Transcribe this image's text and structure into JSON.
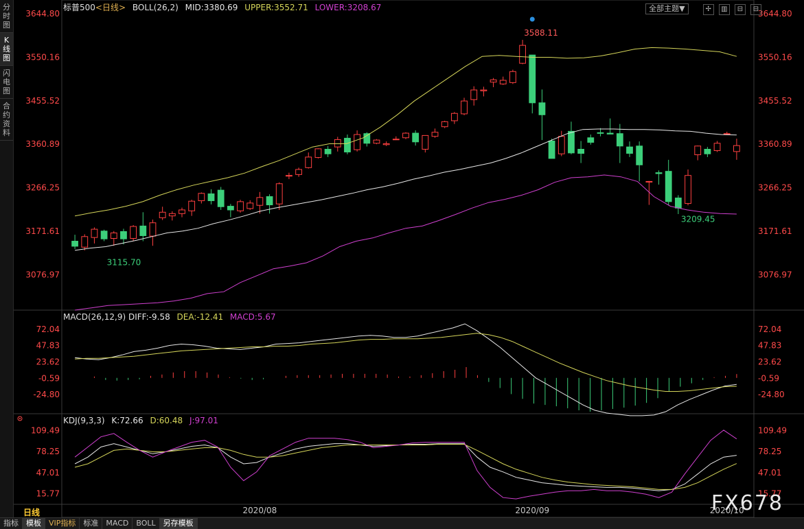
{
  "sidebar": {
    "tabs": [
      {
        "label": "分时图",
        "active": false
      },
      {
        "label": "K线图",
        "active": true
      },
      {
        "label": "闪电图",
        "active": false
      },
      {
        "label": "合约资料",
        "active": false
      }
    ]
  },
  "header": {
    "symbol": "标普500",
    "period": "<日线>",
    "boll": "BOLL(26,2)",
    "mid": "MID:3380.69",
    "upper": "UPPER:3552.71",
    "lower": "LOWER:3208.67"
  },
  "topbar": {
    "theme_select": "全部主题▼",
    "buttons": [
      "✢",
      "▥",
      "⊟",
      "⊟"
    ]
  },
  "macd_header": {
    "title": "MACD(26,12,9)",
    "diff": "DIFF:-9.58",
    "dea": "DEA:-12.41",
    "macd": "MACD:5.67"
  },
  "kdj_header": {
    "title": "KDJ(9,3,3)",
    "k": "K:72.66",
    "d": "D:60.48",
    "j": "J:97.01"
  },
  "period_label": "日线",
  "bottom_tabs": [
    {
      "label": "指标",
      "active": false,
      "vip": false
    },
    {
      "label": "模板",
      "active": true,
      "vip": false
    },
    {
      "label": "VIP指标",
      "active": false,
      "vip": true
    },
    {
      "label": "标准",
      "active": false,
      "vip": false
    },
    {
      "label": "MACD",
      "active": false,
      "vip": false
    },
    {
      "label": "BOLL",
      "active": false,
      "vip": false
    },
    {
      "label": "另存模板",
      "active": true,
      "vip": false
    }
  ],
  "watermark": "FX678",
  "colors": {
    "up": "#ff4040",
    "down": "#3ccf7a",
    "mid": "#e8e8e8",
    "upper": "#d6d65a",
    "lower": "#d040d0",
    "axis": "#ff4a4a",
    "dea": "#d6d65a",
    "j": "#d040d0"
  },
  "chart_data": {
    "type": "candlestick",
    "price_axis": {
      "ticks": [
        "3644.80",
        "3550.16",
        "3455.52",
        "3360.89",
        "3266.25",
        "3171.61",
        "3076.97"
      ],
      "range": [
        3000,
        3644.8
      ]
    },
    "x_labels": [
      "2020/08",
      "2020/09",
      "2020/10"
    ],
    "annotations": {
      "high": "3588.11",
      "low1": "3115.70",
      "low2": "3209.45"
    },
    "candles": [
      [
        3150,
        3164,
        3133,
        3139
      ],
      [
        3137,
        3165,
        3130,
        3160
      ],
      [
        3158,
        3180,
        3145,
        3176
      ],
      [
        3172,
        3175,
        3150,
        3155
      ],
      [
        3156,
        3172,
        3140,
        3168
      ],
      [
        3171,
        3177,
        3143,
        3155
      ],
      [
        3156,
        3185,
        3150,
        3182
      ],
      [
        3183,
        3213,
        3150,
        3162
      ],
      [
        3161,
        3197,
        3140,
        3190
      ],
      [
        3201,
        3225,
        3196,
        3213
      ],
      [
        3205,
        3215,
        3195,
        3210
      ],
      [
        3210,
        3223,
        3202,
        3218
      ],
      [
        3216,
        3240,
        3205,
        3237
      ],
      [
        3238,
        3256,
        3232,
        3254
      ],
      [
        3253,
        3263,
        3230,
        3238
      ],
      [
        3261,
        3268,
        3218,
        3225
      ],
      [
        3226,
        3231,
        3202,
        3218
      ],
      [
        3216,
        3240,
        3212,
        3236
      ],
      [
        3221,
        3239,
        3218,
        3233
      ],
      [
        3228,
        3257,
        3210,
        3245
      ],
      [
        3247,
        3252,
        3210,
        3229
      ],
      [
        3231,
        3278,
        3218,
        3275
      ],
      [
        3293,
        3299,
        3285,
        3293
      ],
      [
        3295,
        3310,
        3290,
        3306
      ],
      [
        3310,
        3343,
        3308,
        3333
      ],
      [
        3332,
        3352,
        3330,
        3351
      ],
      [
        3350,
        3357,
        3333,
        3340
      ],
      [
        3355,
        3377,
        3345,
        3371
      ],
      [
        3374,
        3382,
        3339,
        3344
      ],
      [
        3349,
        3391,
        3345,
        3382
      ],
      [
        3384,
        3387,
        3356,
        3363
      ],
      [
        3363,
        3372,
        3361,
        3370
      ],
      [
        3360,
        3367,
        3357,
        3362
      ],
      [
        3372,
        3378,
        3370,
        3372
      ],
      [
        3375,
        3387,
        3372,
        3385
      ],
      [
        3385,
        3391,
        3358,
        3366
      ],
      [
        3350,
        3380,
        3343,
        3380
      ],
      [
        3378,
        3395,
        3375,
        3387
      ],
      [
        3399,
        3412,
        3396,
        3410
      ],
      [
        3412,
        3431,
        3405,
        3428
      ],
      [
        3427,
        3462,
        3424,
        3455
      ],
      [
        3458,
        3487,
        3445,
        3479
      ],
      [
        3477,
        3486,
        3465,
        3479
      ],
      [
        3496,
        3505,
        3485,
        3501
      ],
      [
        3492,
        3508,
        3490,
        3500
      ],
      [
        3495,
        3523,
        3492,
        3519
      ],
      [
        3537,
        3588,
        3535,
        3576
      ],
      [
        3555,
        3555,
        3428,
        3451
      ],
      [
        3451,
        3480,
        3370,
        3425
      ],
      [
        3368,
        3373,
        3330,
        3330
      ],
      [
        3340,
        3390,
        3335,
        3378
      ],
      [
        3389,
        3410,
        3339,
        3342
      ],
      [
        3350,
        3368,
        3320,
        3341
      ],
      [
        3375,
        3382,
        3360,
        3365
      ],
      [
        3386,
        3396,
        3378,
        3385
      ],
      [
        3385,
        3417,
        3383,
        3383
      ],
      [
        3384,
        3405,
        3320,
        3357
      ],
      [
        3355,
        3367,
        3333,
        3341
      ],
      [
        3357,
        3367,
        3280,
        3316
      ],
      [
        3280,
        3281,
        3229,
        3280
      ],
      [
        3299,
        3304,
        3273,
        3297
      ],
      [
        3302,
        3327,
        3228,
        3236
      ],
      [
        3244,
        3250,
        3209,
        3222
      ],
      [
        3232,
        3306,
        3228,
        3293
      ],
      [
        3338,
        3358,
        3326,
        3357
      ],
      [
        3350,
        3355,
        3333,
        3340
      ],
      [
        3347,
        3368,
        3344,
        3363
      ],
      [
        3383,
        3388,
        3381,
        3384
      ],
      [
        3345,
        3373,
        3327,
        3358
      ]
    ],
    "mid": [
      3130,
      3135,
      3138,
      3145,
      3152,
      3160,
      3168,
      3172,
      3178,
      3188,
      3196,
      3205,
      3215,
      3222,
      3228,
      3234,
      3240,
      3247,
      3254,
      3262,
      3268,
      3276,
      3285,
      3292,
      3300,
      3306,
      3313,
      3320,
      3330,
      3342,
      3356,
      3370,
      3384,
      3393,
      3394,
      3394,
      3393,
      3393,
      3392,
      3390,
      3389,
      3385,
      3382,
      3381
    ],
    "upper": [
      3205,
      3212,
      3218,
      3226,
      3236,
      3250,
      3262,
      3272,
      3280,
      3288,
      3298,
      3312,
      3325,
      3340,
      3355,
      3362,
      3362,
      3375,
      3398,
      3425,
      3455,
      3480,
      3505,
      3530,
      3552,
      3554,
      3552,
      3550,
      3550,
      3548,
      3549,
      3553,
      3560,
      3568,
      3571,
      3570,
      3568,
      3565,
      3562,
      3552
    ],
    "lower": [
      3000,
      3005,
      3010,
      3012,
      3014,
      3016,
      3020,
      3026,
      3036,
      3040,
      3060,
      3075,
      3090,
      3096,
      3103,
      3118,
      3138,
      3150,
      3157,
      3168,
      3178,
      3183,
      3195,
      3208,
      3222,
      3234,
      3241,
      3250,
      3262,
      3278,
      3288,
      3290,
      3294,
      3290,
      3280,
      3247,
      3226,
      3218,
      3213,
      3210,
      3209
    ],
    "macd": {
      "ticks": [
        "72.04",
        "47.83",
        "23.62",
        "-0.59",
        "-24.80"
      ],
      "diff": [
        30,
        28,
        27,
        30,
        34,
        39,
        41,
        44,
        48,
        50,
        49,
        47,
        44,
        43,
        42,
        44,
        46,
        50,
        51,
        52,
        54,
        56,
        58,
        60,
        62,
        63,
        62,
        60,
        60,
        62,
        66,
        70,
        74,
        80,
        70,
        58,
        45,
        30,
        15,
        0,
        -10,
        -20,
        -30,
        -40,
        -48,
        -52,
        -54,
        -56,
        -56,
        -55,
        -50,
        -40,
        -32,
        -25,
        -18,
        -12,
        -9.58
      ],
      "dea": [
        28,
        29,
        29,
        30,
        31,
        32,
        34,
        36,
        38,
        40,
        41,
        42,
        43,
        44,
        45,
        46,
        46,
        47,
        47,
        48,
        50,
        51,
        52,
        54,
        56,
        57,
        57,
        58,
        58,
        58,
        59,
        60,
        62,
        64,
        66,
        64,
        60,
        54,
        46,
        38,
        30,
        22,
        15,
        8,
        2,
        -4,
        -8,
        -12,
        -15,
        -18,
        -20,
        -20,
        -19,
        -17,
        -15,
        -13,
        -12.41
      ],
      "hist": [
        2,
        -3,
        -4,
        -3,
        -2,
        3,
        5,
        8,
        10,
        10,
        8,
        5,
        1,
        -1,
        -3,
        -2,
        0,
        3,
        4,
        4,
        4,
        5,
        6,
        6,
        6,
        6,
        5,
        2,
        2,
        4,
        7,
        10,
        12,
        16,
        4,
        -6,
        -15,
        -24,
        -31,
        -38,
        -40,
        -42,
        -45,
        -48,
        -50,
        -48,
        -46,
        -44,
        -41,
        -37,
        -30,
        -20,
        -13,
        -8,
        -3,
        1,
        3,
        5.67
      ],
      "range": [
        -50,
        80
      ]
    },
    "kdj": {
      "ticks": [
        "109.49",
        "78.25",
        "47.01",
        "15.77"
      ],
      "k": [
        60,
        70,
        85,
        90,
        85,
        80,
        75,
        78,
        82,
        86,
        88,
        84,
        70,
        60,
        62,
        70,
        76,
        82,
        86,
        88,
        90,
        90,
        88,
        86,
        87,
        88,
        89,
        89,
        90,
        90,
        90,
        70,
        55,
        48,
        40,
        36,
        32,
        30,
        28,
        27,
        26,
        25,
        25,
        24,
        22,
        20,
        22,
        30,
        45,
        60,
        70,
        72.66
      ],
      "d": [
        55,
        60,
        70,
        80,
        82,
        80,
        78,
        78,
        80,
        82,
        84,
        84,
        80,
        74,
        70,
        70,
        72,
        76,
        80,
        84,
        86,
        88,
        88,
        88,
        88,
        88,
        88,
        88,
        89,
        89,
        89,
        80,
        70,
        60,
        52,
        46,
        40,
        36,
        33,
        31,
        29,
        28,
        27,
        26,
        24,
        22,
        22,
        25,
        32,
        42,
        52,
        60.48
      ],
      "j": [
        70,
        85,
        100,
        105,
        92,
        80,
        70,
        78,
        85,
        92,
        95,
        85,
        55,
        35,
        48,
        72,
        82,
        92,
        98,
        98,
        98,
        96,
        92,
        84,
        86,
        88,
        91,
        92,
        92,
        92,
        92,
        50,
        25,
        10,
        8,
        12,
        15,
        18,
        20,
        20,
        22,
        20,
        20,
        18,
        15,
        10,
        18,
        45,
        70,
        95,
        110,
        97.01
      ],
      "range": [
        0,
        115
      ]
    }
  }
}
